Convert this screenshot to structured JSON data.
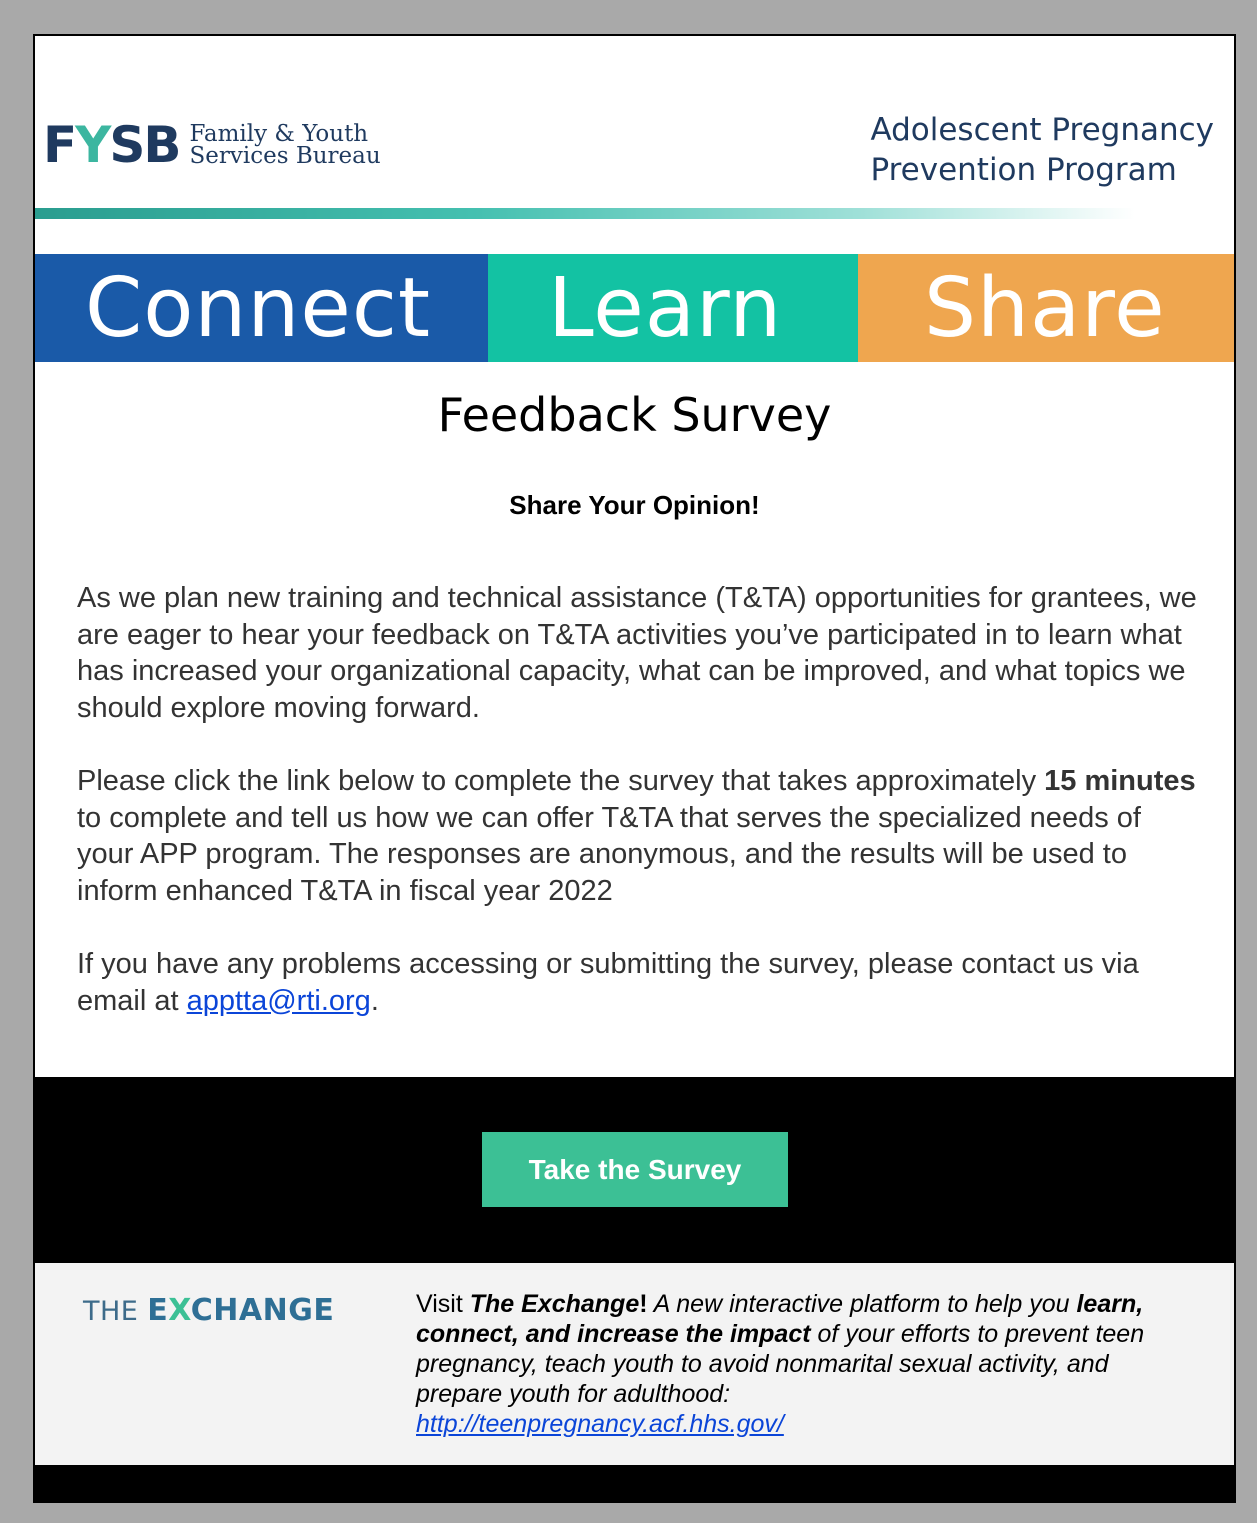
{
  "header": {
    "fysb_mark": "FYSB",
    "fysb_name_line1": "Family & Youth",
    "fysb_name_line2": "Services Bureau",
    "program_line1": "Adolescent Pregnancy",
    "program_line2": "Prevention Program"
  },
  "banner": {
    "connect": "Connect",
    "learn": "Learn",
    "share": "Share",
    "colors": {
      "connect": "#1a5aa8",
      "learn": "#13c2a3",
      "share": "#efa64f"
    }
  },
  "main": {
    "title": "Feedback Survey",
    "subtitle": "Share Your Opinion!",
    "para1": "As we plan new training and technical assistance (T&TA) opportunities for grantees, we are eager to hear your feedback on T&TA activities you’ve participated in to learn what has increased your organizational capacity, what can be improved, and what topics we should explore moving forward.",
    "para2_before": "Please click the link below to complete the survey that takes approximately ",
    "para2_bold": "15 minutes",
    "para2_after": " to complete and tell us how we can offer T&TA that serves the specialized needs of your APP program. The responses are anonymous, and the results will be used to inform enhanced T&TA in fiscal year 2022",
    "para3_before": "If you have any problems accessing or submitting the survey, please contact us via email at ",
    "email": "apptta@rti.org",
    "para3_after": "."
  },
  "cta": {
    "button_label": "Take the Survey",
    "button_color": "#3cc095"
  },
  "footer": {
    "logo_the": "THE",
    "logo_ex_a": "E",
    "logo_ex_x": "X",
    "logo_ex_b": "CHANGE",
    "visit": "Visit ",
    "exchange_name": "The Exchange",
    "bang": "!",
    "desc_part1": " A new interactive platform to help you ",
    "desc_bold": "learn, connect, and increase the impact",
    "desc_part2": " of your efforts to prevent teen pregnancy, teach youth to avoid nonmarital sexual activity, and prepare youth for adulthood:",
    "link": "http://teenpregnancy.acf.hhs.gov/"
  }
}
